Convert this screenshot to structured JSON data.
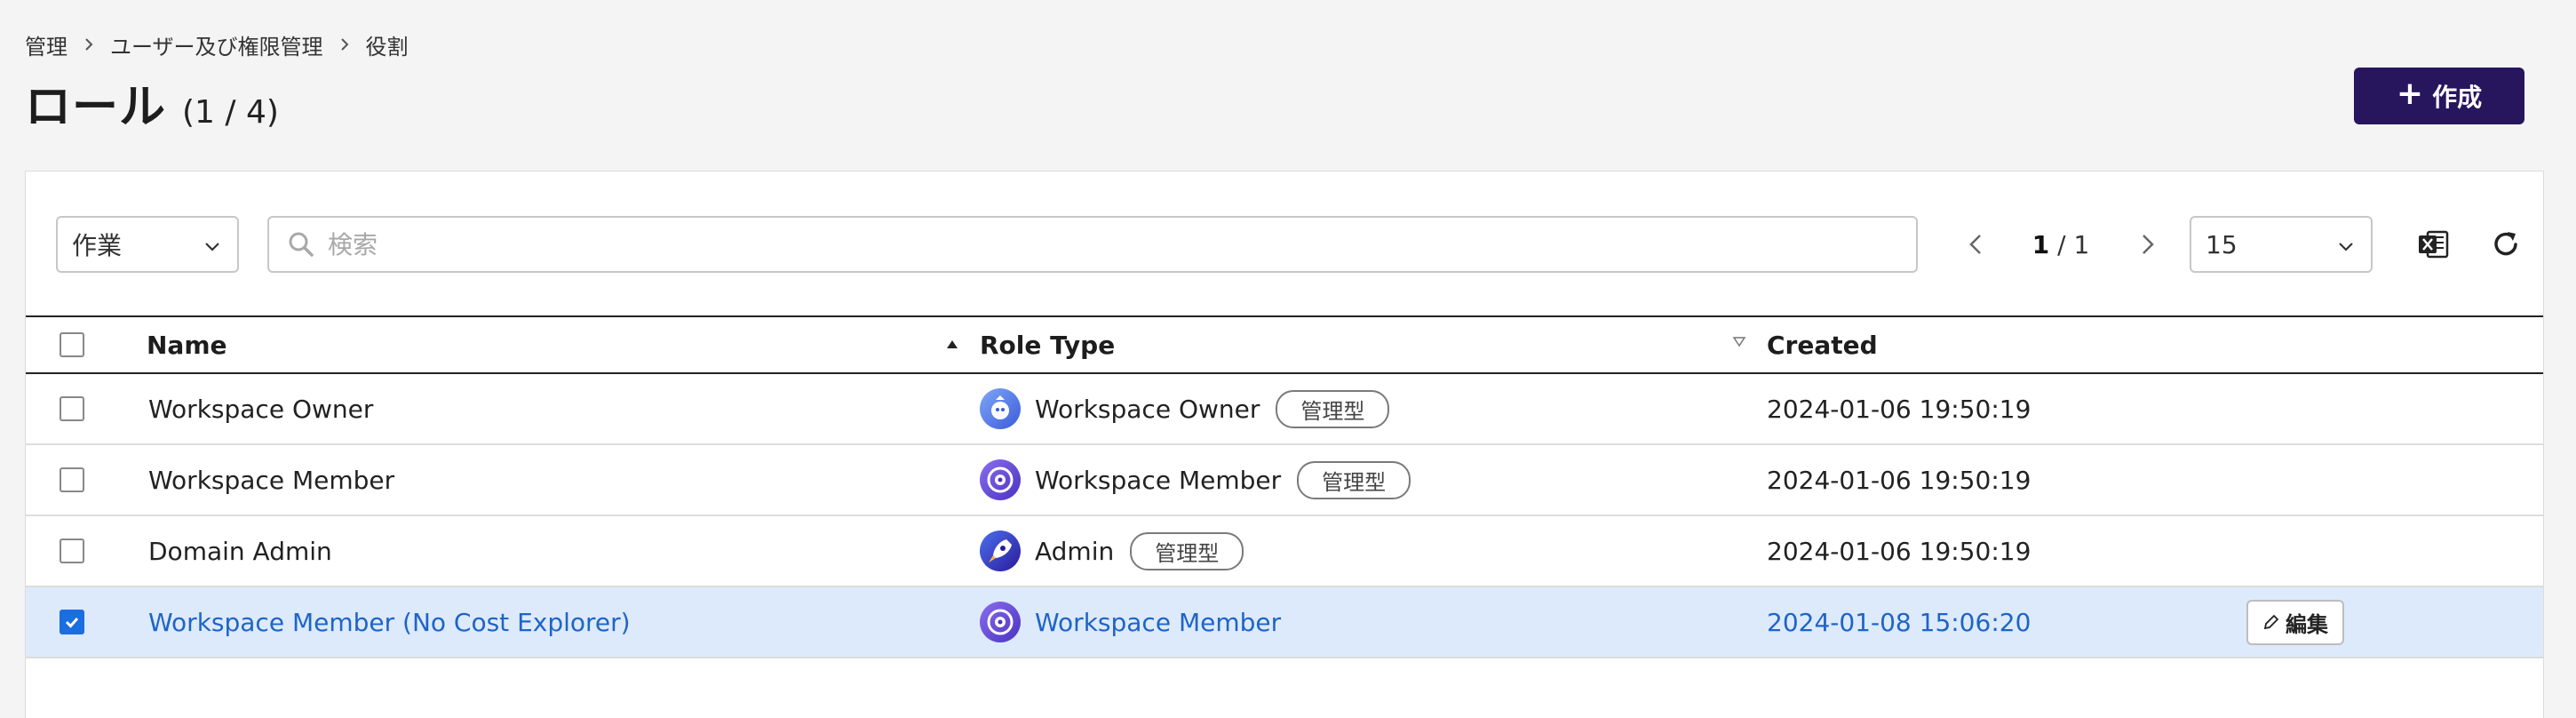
{
  "breadcrumb": [
    {
      "label": "管理"
    },
    {
      "label": "ユーザー及び権限管理"
    },
    {
      "label": "役割"
    }
  ],
  "page": {
    "title": "ロール",
    "count": "(1 / 4)",
    "create_label": "作成"
  },
  "toolbar": {
    "action_select_value": "作業",
    "search_placeholder": "検索",
    "page_current": "1",
    "page_total": "/ 1",
    "page_size_value": "15"
  },
  "table": {
    "columns": {
      "name": "Name",
      "role_type": "Role Type",
      "created": "Created"
    },
    "rows": [
      {
        "name": "Workspace Owner",
        "role_type": "Workspace Owner",
        "badge": "管理型",
        "created": "2024-01-06 19:50:19",
        "checked": false
      },
      {
        "name": "Workspace Member",
        "role_type": "Workspace Member",
        "badge": "管理型",
        "created": "2024-01-06 19:50:19",
        "checked": false
      },
      {
        "name": "Domain Admin",
        "role_type": "Admin",
        "badge": "管理型",
        "created": "2024-01-06 19:50:19",
        "checked": false
      },
      {
        "name": "Workspace Member (No Cost Explorer)",
        "role_type": "Workspace Member",
        "badge": "",
        "created": "2024-01-08 15:06:20",
        "checked": true,
        "edit_label": "編集"
      }
    ]
  },
  "colors": {
    "primary": "#27165e",
    "link": "#1e64c8",
    "selected_row": "#ddeafb",
    "checkbox": "#1a6edf"
  }
}
